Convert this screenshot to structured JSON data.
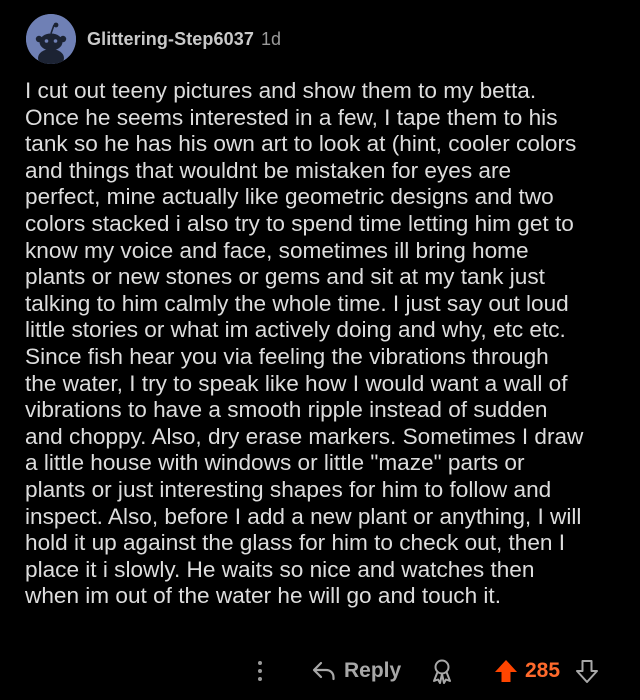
{
  "comment": {
    "username": "Glittering-Step6037",
    "timestamp": "1d",
    "body_lines": [
      "I cut out teeny pictures and show them to my betta.",
      "Once he seems interested in a few, I tape them to his",
      "tank so he has his own art to look at (hint, cooler colors",
      "and things that wouldnt be mistaken for eyes are",
      "perfect, mine actually like geometric designs and two",
      "colors stacked i also try to spend time letting him get to",
      "know my voice and face, sometimes ill bring home",
      "plants or new stones or gems and sit at my tank just",
      "talking to him calmly the whole time. I just say out loud",
      "little stories or what im actively doing and why, etc etc.",
      "Since fish hear you via feeling the vibrations through",
      "the water, I try to speak like how I would want a wall of",
      "vibrations to have a smooth ripple instead of sudden",
      "and choppy. Also, dry erase markers. Sometimes I draw",
      "a little house with windows or little \"maze\" parts or",
      "plants or just interesting shapes for him to follow and",
      "inspect. Also, before I add a new plant or anything, I will",
      "hold it up against the glass for him to check out, then I",
      "place it i slowly. He waits so nice and watches then",
      "when im out of the water he will go and touch it."
    ]
  },
  "actions": {
    "reply_label": "Reply",
    "score": "285",
    "icons": {
      "more": "more-vertical-icon",
      "reply": "reply-arrow-icon",
      "award": "award-icon",
      "upvote": "upvote-arrow-icon",
      "downvote": "downvote-arrow-icon"
    }
  },
  "colors": {
    "background": "#000000",
    "text": "#dddddd",
    "username": "#c9c9c9",
    "muted": "#9a9a9a",
    "upvote_accent": "#ff6a2c",
    "avatar_bg": "#6f80b5"
  }
}
